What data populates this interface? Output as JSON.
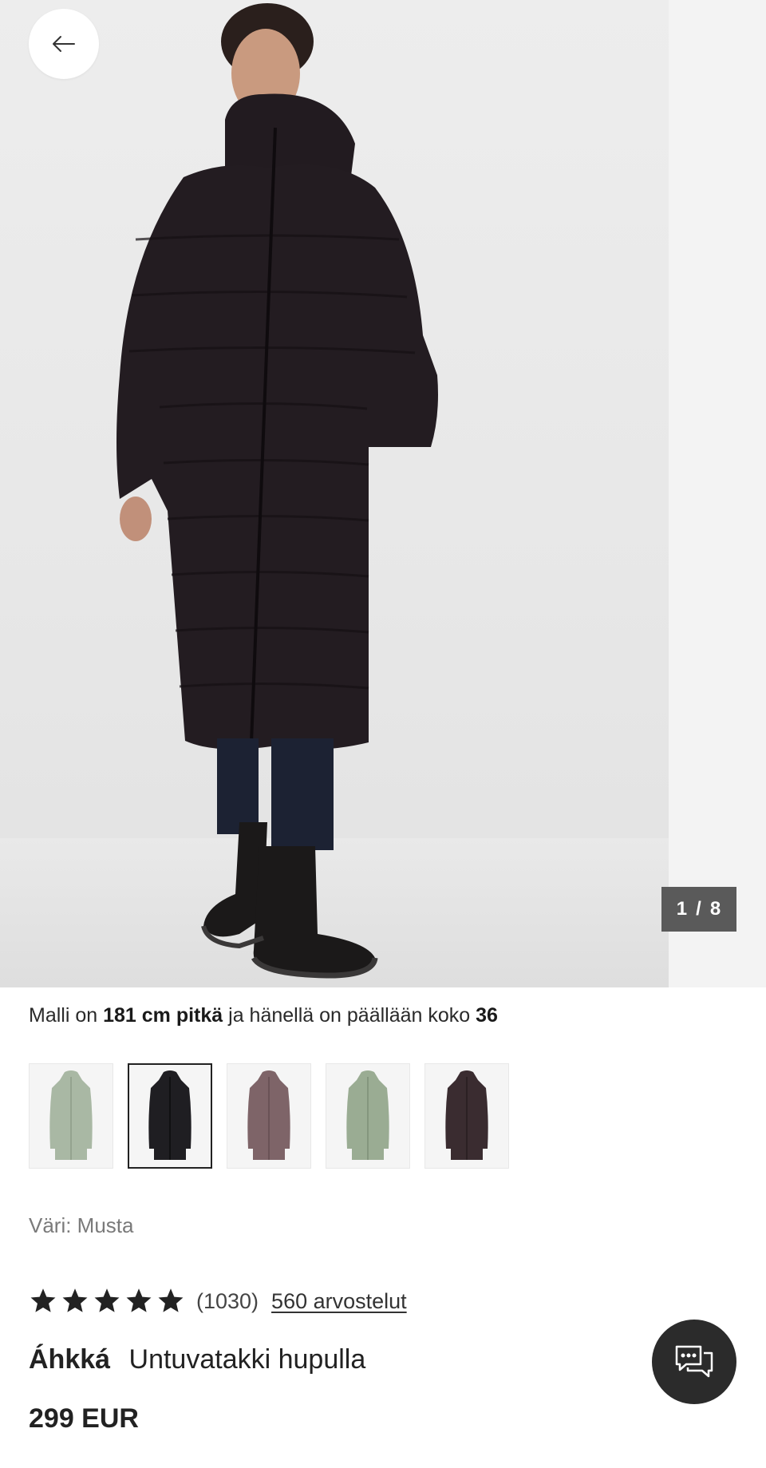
{
  "gallery": {
    "current": "1",
    "separator": "/",
    "total": "8",
    "main_image": "model-wearing-long-black-down-coat"
  },
  "icons": {
    "back": "arrow-left-icon",
    "chat": "chat-bubbles-icon",
    "star": "star-icon"
  },
  "model_info": {
    "prefix": "Malli on",
    "height": "181 cm pitkä",
    "middle": "ja hänellä on päällään koko",
    "size": "36"
  },
  "swatches": [
    {
      "color": "#a9b8a4",
      "selected": false
    },
    {
      "color": "#1f1e22",
      "selected": true
    },
    {
      "color": "#7e6468",
      "selected": false
    },
    {
      "color": "#9aac93",
      "selected": false
    },
    {
      "color": "#3a2c30",
      "selected": false
    }
  ],
  "color": {
    "label": "Väri: Musta"
  },
  "rating": {
    "stars": 5,
    "count": "(1030)",
    "reviews": "560 arvostelut"
  },
  "product": {
    "brand": "Áhkká",
    "name": "Untuvatakki hupulla",
    "price": "299 EUR"
  },
  "colors": {
    "counter_bg": "#5a5a5a",
    "chat_bg": "#2b2b2b",
    "coat": "#231c21"
  }
}
